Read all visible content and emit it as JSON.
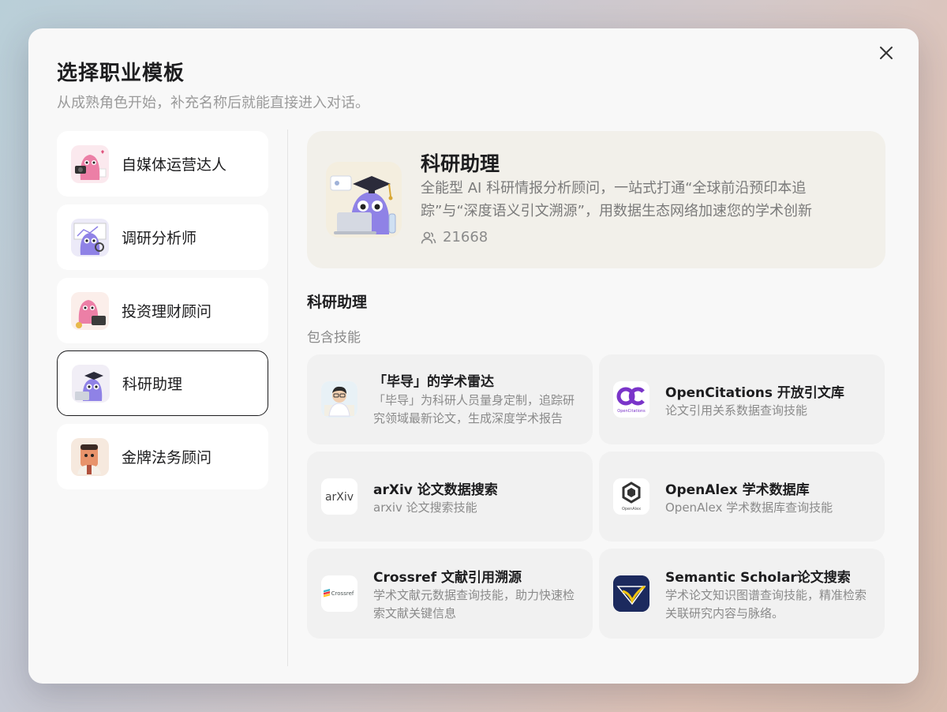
{
  "dialog": {
    "title": "选择职业模板",
    "subtitle": "从成熟角色开始，补充名称后就能直接进入对话。"
  },
  "roles": [
    {
      "label": "自媒体运营达人",
      "icon": "media-mascot-icon"
    },
    {
      "label": "调研分析师",
      "icon": "analyst-mascot-icon"
    },
    {
      "label": "投资理财顾问",
      "icon": "investment-mascot-icon"
    },
    {
      "label": "科研助理",
      "icon": "research-mascot-icon",
      "selected": true
    },
    {
      "label": "金牌法务顾问",
      "icon": "legal-mascot-icon"
    }
  ],
  "detail": {
    "name": "科研助理",
    "description": "全能型 AI 科研情报分析顾问，一站式打通“全球前沿预印本追踪”与“深度语义引文溯源”，用数据生态网络加速您的学术创新",
    "user_count": "21668",
    "section_title": "科研助理",
    "skills_label": "包含技能"
  },
  "skills": [
    {
      "title": "「毕导」的学术雷达",
      "desc": "「毕导」为科研人员量身定制，追踪研究领域最新论文，生成深度学术报告",
      "icon": "bidao-avatar-icon"
    },
    {
      "title": "OpenCitations 开放引文库",
      "desc": "论文引用关系数据查询技能",
      "icon": "opencitations-logo-icon"
    },
    {
      "title": "arXiv 论文数据搜索",
      "desc": "arxiv 论文搜索技能",
      "icon": "arxiv-logo-icon"
    },
    {
      "title": "OpenAlex 学术数据库",
      "desc": "OpenAlex 学术数据库查询技能",
      "icon": "openalex-logo-icon"
    },
    {
      "title": "Crossref 文献引用溯源",
      "desc": "学术文献元数据查询技能，助力快速检索文献关键信息",
      "icon": "crossref-logo-icon"
    },
    {
      "title": "Semantic Scholar论文搜索",
      "desc": "学术论文知识图谱查询技能，精准检索关联研究内容与脉络。",
      "icon": "semantic-scholar-logo-icon"
    }
  ],
  "logos": {
    "opencitations_text": "OpenCitations",
    "arxiv_text": "arXiv",
    "openalex_text": "OpenAlex",
    "crossref_text": "Crossref"
  },
  "colors": {
    "selected_border": "#1d1d1f",
    "hero_bg": "#f2f0ea",
    "card_bg": "#f1f1f1",
    "mascot_purple": "#8f82e6",
    "mascot_pink": "#ec7fa6",
    "opencitations_purple": "#7a34c9",
    "arxiv_red": "#b31b1b",
    "semantic_scholar_navy": "#1c2a5e",
    "semantic_scholar_gold": "#f1c40f"
  }
}
